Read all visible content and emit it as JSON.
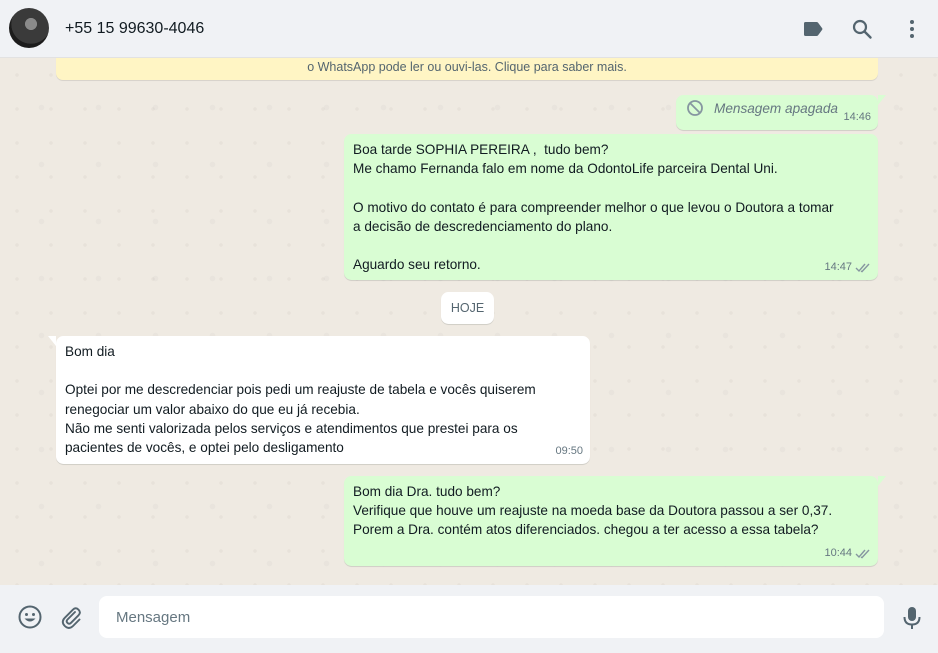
{
  "header": {
    "contact_name": "+55 15 99630-4046",
    "icons": [
      "avatar",
      "label-icon",
      "search-icon",
      "menu-icon"
    ]
  },
  "chat": {
    "encryption_notice": "o WhatsApp pode ler ou ouvi-las. Clique para saber mais.",
    "messages": [
      {
        "direction": "out",
        "deleted": true,
        "text": "Mensagem apagada",
        "time": "14:46"
      },
      {
        "direction": "out",
        "text": "Boa tarde SOPHIA PEREIRA ,  tudo bem?\nMe chamo Fernanda falo em nome da OdontoLife parceira Dental Uni.\n\nO motivo do contato é para compreender melhor o que levou o Doutora a tomar\na decisão de descredenciamento do plano.\n\nAguardo seu retorno.",
        "time": "14:47",
        "status": "read"
      },
      {
        "direction": "in",
        "text": "Bom dia\n\nOptei por me descredenciar pois pedi um reajuste de tabela e vocês quiserem\nrenegociar um valor abaixo do que eu já recebia.\nNão me senti valorizada pelos serviços e atendimentos que prestei para os\npacientes de vocês, e optei pelo desligamento",
        "time": "09:50"
      },
      {
        "direction": "out",
        "text": "Bom dia Dra. tudo bem?\nVerifique que houve um reajuste na moeda base da Doutora passou a ser 0,37.\nPorem a Dra. contém atos diferenciados. chegou a ter acesso a essa tabela?",
        "time": "10:44",
        "status": "read"
      }
    ],
    "day_separator": "HOJE"
  },
  "footer": {
    "input_placeholder": "Mensagem",
    "input_value": "",
    "icons": [
      "emoji-icon",
      "attach-icon",
      "mic-icon"
    ]
  },
  "colors": {
    "outgoing_bubble": "#d9fdd3",
    "incoming_bubble": "#ffffff",
    "notice_background": "#fff5c4",
    "read_ticks": "#8696a0",
    "icon_gray": "#54656f"
  }
}
